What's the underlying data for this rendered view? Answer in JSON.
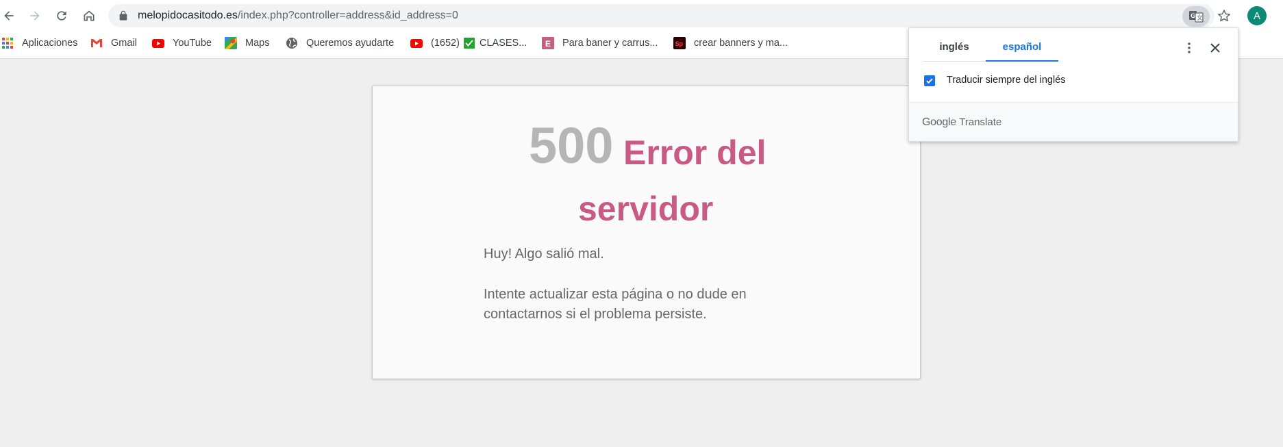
{
  "browser": {
    "url_host": "melopidocasitodo.es",
    "url_path": "/index.php?controller=address&id_address=0",
    "avatar_letter": "A",
    "bookmarks": [
      {
        "label": "Aplicaciones",
        "icon": "apps-grid-icon"
      },
      {
        "label": "Gmail",
        "icon": "gmail-icon"
      },
      {
        "label": "YouTube",
        "icon": "youtube-icon"
      },
      {
        "label": "Maps",
        "icon": "maps-icon"
      },
      {
        "label": "Queremos ayudarte",
        "icon": "globe-icon"
      },
      {
        "label": "(1652)",
        "icon": "youtube-icon"
      },
      {
        "label": "CLASES...",
        "icon": "checkbox-icon"
      },
      {
        "label": "Para baner y carrus...",
        "icon": "e-logo-icon"
      },
      {
        "label": "crear banners y ma...",
        "icon": "sp-logo-icon"
      }
    ]
  },
  "error_page": {
    "code": "500",
    "title_line1": "Error del",
    "title_line2": "servidor",
    "message1": "Huy! Algo salió mal.",
    "message2": "Intente actualizar esta página o no dude en contactarnos si el problema persiste."
  },
  "translate_popup": {
    "tab_source": "inglés",
    "tab_target": "español",
    "always_translate_label": "Traducir siempre del inglés",
    "always_translate_checked": true,
    "footer_brand": "Google",
    "footer_product": "Translate"
  },
  "colors": {
    "accent": "#1a73e8",
    "error_title": "#c95b82",
    "error_code": "#b5b5b5"
  }
}
